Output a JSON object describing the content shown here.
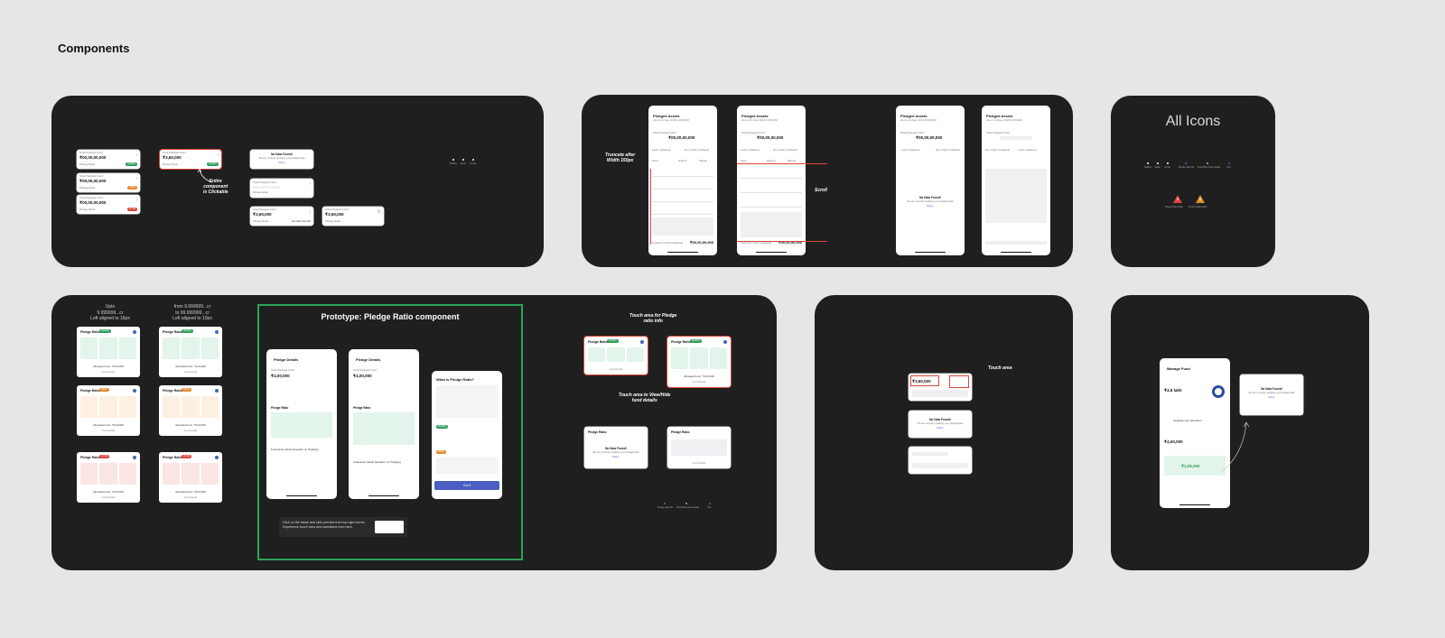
{
  "page": {
    "title": "Components"
  },
  "colors": {
    "canvas": "#e6e6e6",
    "board": "#1f1f1f",
    "accent_green": "#2e9e5b",
    "accent_orange": "#e68a2e",
    "accent_red": "#d9453b",
    "accent_blue": "#4a5fc1",
    "prototype_border": "#2ea35a"
  },
  "board1": {
    "card_label": "Total Pledged Fund",
    "amount_large": "₹00,00,00,000",
    "amount_small": "₹3,60,000",
    "ratio_label": "Pledge Ratio",
    "empty_title": "No Data Found!",
    "empty_sub": "We are currently updating your pledged data",
    "retry": "Retry",
    "annotation": "Entire\ncomponent\nis Clickable",
    "legend": [
      "Healthy",
      "Weak",
      "At risk"
    ]
  },
  "board2": {
    "screen_title": "Pledged Assets",
    "screen_sub": "As on 14 Aug, 2024 10:00 AM",
    "total_label": "Total Pledged Fund",
    "total_value": "₹00,00,00,000",
    "tabs": [
      "Cash Collateral",
      "Non Cash Collateral"
    ],
    "cols": [
      "Scrip",
      "Haircut",
      "Margin"
    ],
    "footer_label": "Total Non Cash Collateral",
    "footer_value": "₹00,00,00,000",
    "empty_title": "No Data Found!",
    "empty_sub": "We are currently updating your pledged data",
    "retry": "Retry",
    "annot_truncate": "Truncate after\nWidth 150px",
    "annot_scroll": "Scroll"
  },
  "board3": {
    "title": "All Icons",
    "icons": [
      "Healthy",
      "Weak",
      "At risk",
      "Pledge ratio info",
      "Show/Hide Fund details",
      "Info"
    ],
    "warnings": [
      "Weak funds health",
      "At risk funds health"
    ]
  },
  "board4": {
    "col1_heading": "Upto\n9.999999...cr\nLeft aligned to 16px",
    "col2_heading": "from 9.999999...cr\nto 99.999999...cr\nLeft aligned to 10px",
    "prototype_title": "Prototype: Pledge Ratio component",
    "ratio_title": "Pledge Ratio",
    "pledge_details": "Pledge Details",
    "total_label": "Total Pledged Fund",
    "total_value": "₹4,00,000",
    "faq": "Frequently Asked Question on Pledging",
    "what_title": "What is Pledge Ratio?",
    "got_it": "Got It",
    "hint": "Click on the frame and click preview from top right corner. Experience touch area and transitions from here.",
    "annot_touch_ratio": "Touch area for Pledge\nratio info",
    "annot_touch_fund": "Touch area to View/Hide\nfund details",
    "empty_title": "No Data Found!",
    "empty_sub": "We are currently updating your pledged data",
    "retry": "Retry",
    "legend": [
      "Pledge ratio info",
      "Show/Hide Fund details",
      "Info"
    ],
    "allocated": "Allocated Fund : ₹4,00,000",
    "fund_details": "Fund Details",
    "ratio_badges": [
      "Healthy",
      "Weak",
      "At risk"
    ]
  },
  "board5": {
    "amount": "₹3,60,000",
    "annot_touch": "Touch area",
    "empty_title": "No Data Found!",
    "empty_sub": "We are currently updating your pledged data",
    "retry": "Retry"
  },
  "board6": {
    "screen_title": "Manage Fund",
    "allocated_value": "₹4.8 lakh",
    "upgrade": "Upgrade your allocation",
    "pledged_value": "₹4,00,000",
    "withdraw_value": "₹2,05,000",
    "empty_title": "No Data Found!",
    "empty_sub": "We are currently updating your pledged data",
    "retry": "Retry"
  }
}
